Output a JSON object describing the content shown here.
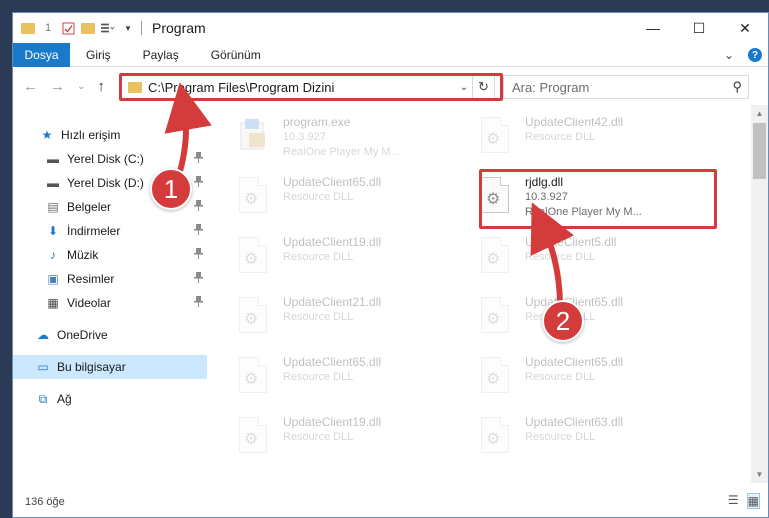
{
  "window": {
    "title": "Program",
    "controls": {
      "minimize": "—",
      "maximize": "☐",
      "close": "✕"
    }
  },
  "qat": {
    "number": "1"
  },
  "ribbon": {
    "tabs": [
      "Dosya",
      "Giriş",
      "Paylaş",
      "Görünüm"
    ],
    "expand": "⌄",
    "help": "?"
  },
  "nav": {
    "back": "←",
    "forward": "→",
    "recent": "⌄",
    "up": "↑",
    "address": "C:\\Program Files\\Program Dizini",
    "address_dropdown": "⌄",
    "refresh": "↻",
    "search_placeholder": "Ara: Program",
    "search_glyph": "⚲"
  },
  "sidebar": {
    "items": [
      {
        "label": "Hızlı erişim",
        "icon": "star-icon",
        "glyph": "★",
        "color": "#1979ca",
        "pinned": false
      },
      {
        "label": "Yerel Disk (C:)",
        "icon": "drive-icon",
        "glyph": "▬",
        "color": "#555555",
        "pinned": true
      },
      {
        "label": "Yerel Disk (D:)",
        "icon": "drive-icon",
        "glyph": "▬",
        "color": "#555555",
        "pinned": true
      },
      {
        "label": "Belgeler",
        "icon": "documents-icon",
        "glyph": "▤",
        "color": "#6d6d6d",
        "pinned": true
      },
      {
        "label": "İndirmeler",
        "icon": "download-icon",
        "glyph": "⬇",
        "color": "#1979ca",
        "pinned": true
      },
      {
        "label": "Müzik",
        "icon": "music-icon",
        "glyph": "♪",
        "color": "#1979ca",
        "pinned": true
      },
      {
        "label": "Resimler",
        "icon": "pictures-icon",
        "glyph": "▣",
        "color": "#4a7fb5",
        "pinned": true
      },
      {
        "label": "Videolar",
        "icon": "video-icon",
        "glyph": "▦",
        "color": "#444444",
        "pinned": true
      },
      {
        "label": "OneDrive",
        "icon": "onedrive-icon",
        "glyph": "☁",
        "color": "#1979ca",
        "pinned": false
      },
      {
        "label": "Bu bilgisayar",
        "icon": "computer-icon",
        "glyph": "▭",
        "color": "#1979ca",
        "pinned": false,
        "selected": true
      },
      {
        "label": "Ağ",
        "icon": "network-icon",
        "glyph": "⧉",
        "color": "#1979ca",
        "pinned": false
      }
    ],
    "pin_glyph": "📌"
  },
  "files": [
    {
      "name": "program.exe",
      "line2": "10.3.927",
      "line3": "RealOne Player My M...",
      "faded": true,
      "icon": "exe-icon"
    },
    {
      "name": "UpdateClient42.dll",
      "line2": "Resource DLL",
      "line3": "",
      "faded": true,
      "icon": "dll-icon"
    },
    {
      "name": "UpdateClient65.dll",
      "line2": "Resource DLL",
      "line3": "",
      "faded": true,
      "icon": "dll-icon"
    },
    {
      "name": "rjdlg.dll",
      "line2": "10.3.927",
      "line3": "RealOne Player My M...",
      "faded": false,
      "icon": "dll-icon"
    },
    {
      "name": "UpdateClient19.dll",
      "line2": "Resource DLL",
      "line3": "",
      "faded": true,
      "icon": "dll-icon"
    },
    {
      "name": "UpdateClient5.dll",
      "line2": "Resource DLL",
      "line3": "",
      "faded": true,
      "icon": "dll-icon"
    },
    {
      "name": "UpdateClient21.dll",
      "line2": "Resource DLL",
      "line3": "",
      "faded": true,
      "icon": "dll-icon"
    },
    {
      "name": "UpdateClient65.dll",
      "line2": "Resource DLL",
      "line3": "",
      "faded": true,
      "icon": "dll-icon"
    },
    {
      "name": "UpdateClient65.dll",
      "line2": "Resource DLL",
      "line3": "",
      "faded": true,
      "icon": "dll-icon"
    },
    {
      "name": "UpdateClient65.dll",
      "line2": "Resource DLL",
      "line3": "",
      "faded": true,
      "icon": "dll-icon"
    },
    {
      "name": "UpdateClient19.dll",
      "line2": "Resource DLL",
      "line3": "",
      "faded": true,
      "icon": "dll-icon"
    },
    {
      "name": "UpdateClient63.dll",
      "line2": "Resource DLL",
      "line3": "",
      "faded": true,
      "icon": "dll-icon"
    }
  ],
  "status": {
    "count": "136 öğe"
  },
  "annotations": {
    "badge1": "1",
    "badge2": "2",
    "color": "#d43c3c"
  },
  "colors": {
    "accent": "#1979ca",
    "highlight": "#d43c3c",
    "selected_bg": "#cce8ff"
  }
}
